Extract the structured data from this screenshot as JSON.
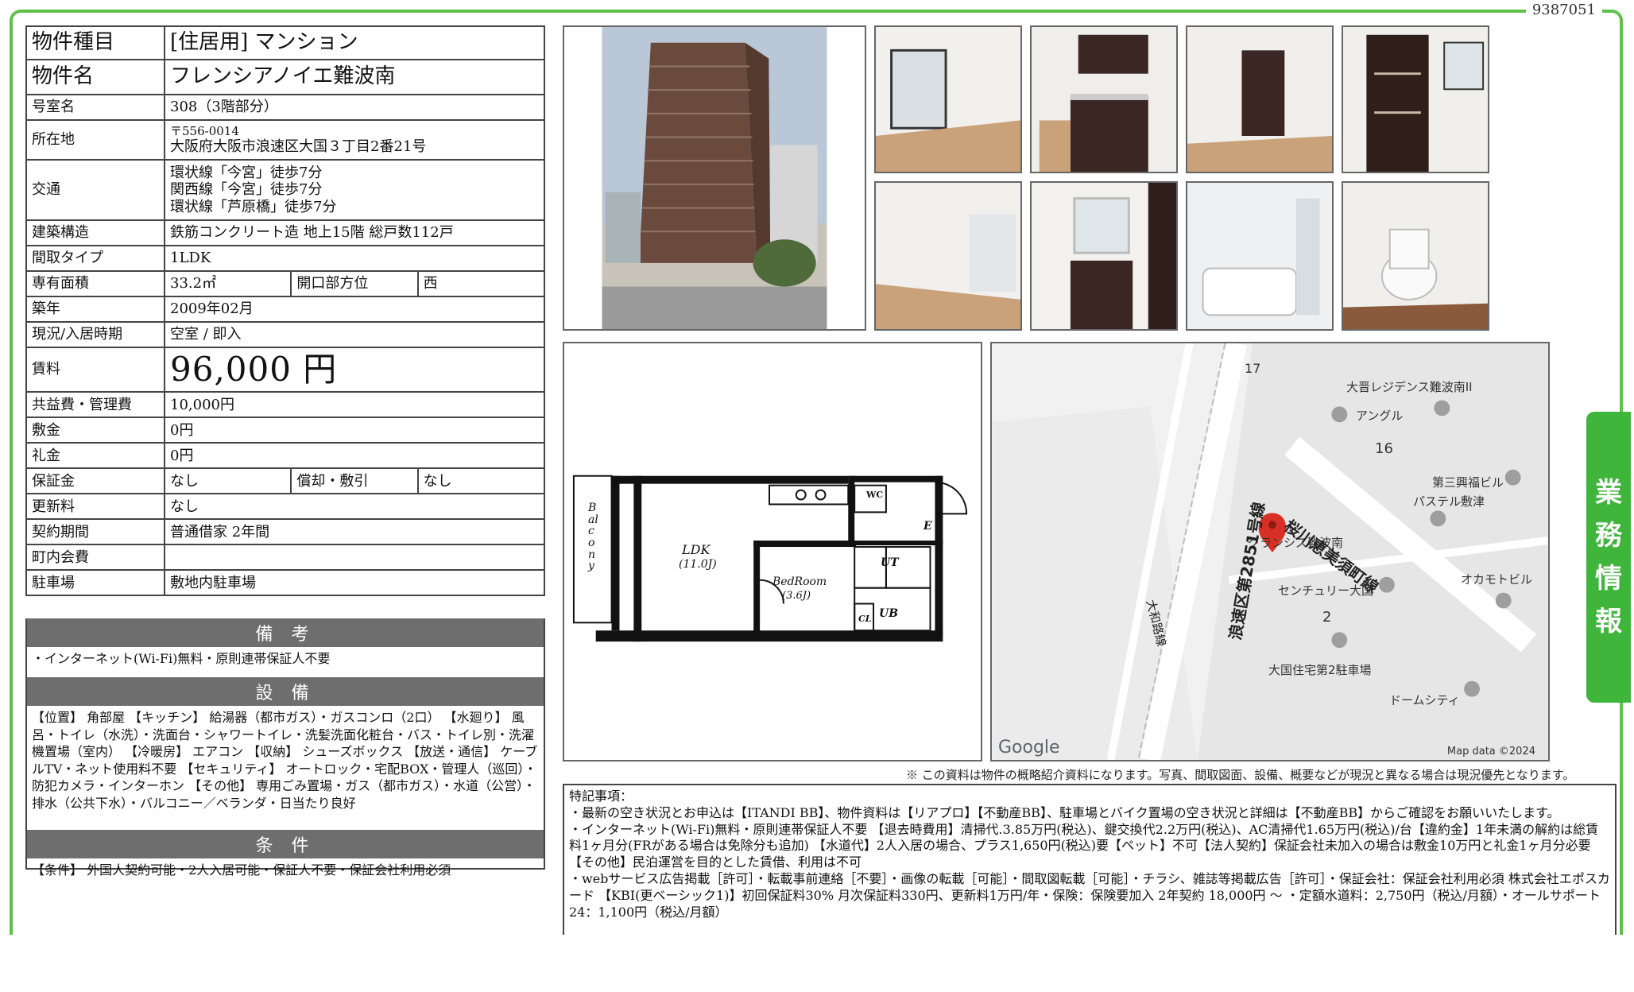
{
  "document_id": "9387051",
  "property": {
    "type_label": "物件種目",
    "type_value": "[住居用] マンション",
    "name_label": "物件名",
    "name_value": "フレンシアノイエ難波南",
    "room_label": "号室名",
    "room_value": "308（3階部分）",
    "address_label": "所在地",
    "postal": "〒556-0014",
    "address": "大阪府大阪市浪速区大国３丁目2番21号",
    "access_label": "交通",
    "access": [
      "環状線「今宮」徒歩7分",
      "関西線「今宮」徒歩7分",
      "環状線「芦原橋」徒歩7分"
    ],
    "structure_label": "建築構造",
    "structure_value": "鉄筋コンクリート造 地上15階 総戸数112戸",
    "layout_label": "間取タイプ",
    "layout_value": "1LDK",
    "area_label": "専有面積",
    "area_value": "33.2㎡",
    "direction_label": "開口部方位",
    "direction_value": "西",
    "built_label": "築年",
    "built_value": "2009年02月",
    "status_label": "現況/入居時期",
    "status_value": "空室 / 即入",
    "rent_label": "賃料",
    "rent_value": "96,000 円",
    "fee_label": "共益費・管理費",
    "fee_value": "10,000円",
    "deposit_label": "敷金",
    "deposit_value": "0円",
    "key_money_label": "礼金",
    "key_money_value": "0円",
    "guarantee_label": "保証金",
    "guarantee_value": "なし",
    "amort_label": "償却・敷引",
    "amort_value": "なし",
    "renewal_label": "更新料",
    "renewal_value": "なし",
    "contract_label": "契約期間",
    "contract_value": "普通借家 2年間",
    "town_fee_label": "町内会費",
    "town_fee_value": "",
    "parking_label": "駐車場",
    "parking_value": "敷地内駐車場"
  },
  "remarks": {
    "title": "備 考",
    "body": "・インターネット(Wi-Fi)無料・原則連帯保証人不要"
  },
  "facilities": {
    "title": "設 備",
    "body": "【位置】 角部屋 【キッチン】 給湯器（都市ガス）・ガスコンロ（2口） 【水廻り】 風呂・トイレ（水洗）・洗面台・シャワートイレ・洗髪洗面化粧台・バス・トイレ別・洗濯機置場（室内） 【冷暖房】 エアコン 【収納】 シューズボックス 【放送・通信】 ケーブルTV・ネット使用料不要 【セキュリティ】 オートロック・宅配BOX・管理人（巡回）・防犯カメラ・インターホン 【その他】 専用ごみ置場・ガス（都市ガス）・水道（公営）・排水（公共下水）・バルコニー／ベランダ・日当たり良好"
  },
  "conditions": {
    "title": "条 件",
    "body": "【条件】 外国人契約可能・2人入居可能・保証人不要・保証会社利用必須"
  },
  "floor_plan": {
    "balcony": "Balcony",
    "ldk": "LDK",
    "ldk_size": "(11.0J)",
    "bedroom": "BedRoom",
    "bedroom_size": "(3.6J)",
    "wc": "WC",
    "entrance": "E",
    "ut": "UT",
    "ub": "UB",
    "cl": "CL"
  },
  "map": {
    "labels": [
      "大晋レジデンス難波南II",
      "アングル",
      "16",
      "第三興福ビル",
      "パステル敷津",
      "グランシス難波南",
      "センチュリー大国",
      "オカモトビル",
      "2",
      "大国住宅第2駐車場",
      "ドームシティ",
      "17"
    ],
    "road1": "桜川恵美須町線",
    "road2": "大和路線",
    "road3": "浪速区第2851号線",
    "google": "Google",
    "credit": "Map data ©2024"
  },
  "disclaimer": "※ この資料は物件の概略紹介資料になります。写真、間取図面、設備、概要などが現況と異なる場合は現況優先となります。",
  "notes": {
    "title": "特記事項：",
    "lines": [
      "・最新の空き状況とお申込は【ITANDI BB】、物件資料は【リアプロ】【不動産BB】、駐車場とバイク置場の空き状況と詳細は【不動産BB】からご確認をお願いいたします。",
      "・インターネット(Wi-Fi)無料・原則連帯保証人不要 【退去時費用】清掃代.3.85万円(税込)、鍵交換代2.2万円(税込)、AC清掃代1.65万円(税込)/台【違約金】1年未満の解約は総賃料1ヶ月分(FRがある場合は免除分も追加) 【水道代】2人入居の場合、プラス1,650円(税込)要【ペット】不可【法人契約】保証会社未加入の場合は敷金10万円と礼金1ヶ月分必要【その他】民泊運営を目的とした賃借、利用は不可",
      "・webサービス広告掲載［許可］・転載事前連絡［不要］・画像の転載［可能］・間取図転載［可能］・チラシ、雑誌等掲載広告［許可］・保証会社：保証会社利用必須 株式会社エポスカード 【KBI(更ベーシック1)】初回保証料30% 月次保証料330円、更新料1万円/年・保険：保険要加入 2年契約 18,000円 〜 ・定額水道料：2,750円（税込/月額）・オールサポート24：1,100円（税込/月額）"
    ]
  },
  "side_tab": [
    "業",
    "務",
    "情",
    "報"
  ]
}
